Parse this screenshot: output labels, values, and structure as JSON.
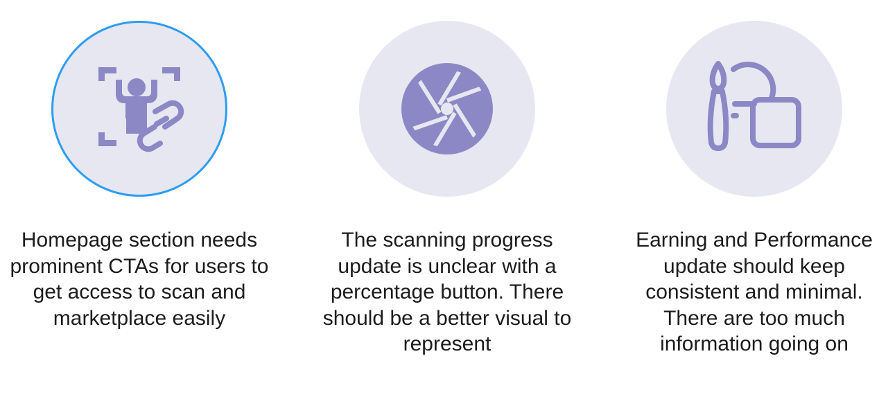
{
  "accent_color": "#8b88c5",
  "selection_color": "#2c9df2",
  "circle_color": "#e7e7f1",
  "cards": [
    {
      "icon": "user-scan-link-icon",
      "selected": true,
      "text": "Homepage section needs prominent CTAs for users to get access to scan and marketplace easily"
    },
    {
      "icon": "camera-aperture-icon",
      "selected": false,
      "text": "The scanning progress update is unclear with a percentage button. There should be a better visual to represent"
    },
    {
      "icon": "brush-shapes-icon",
      "selected": false,
      "text": "Earning and Performance update should keep consistent and minimal. There are too much information going on"
    }
  ]
}
